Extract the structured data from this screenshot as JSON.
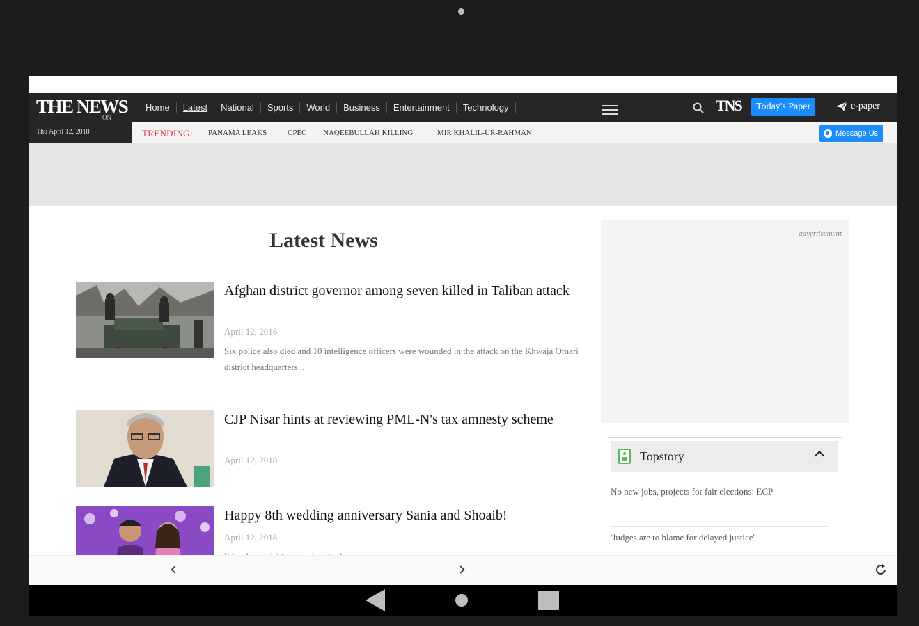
{
  "header": {
    "logo_text": "THE NEWS",
    "logo_tag": "ON",
    "date": "Thu April 12, 2018",
    "nav": [
      "Home",
      "Latest",
      "National",
      "Sports",
      "World",
      "Business",
      "Entertainment",
      "Technology"
    ],
    "active_nav": "Latest",
    "tns_logo": "TNS",
    "todays_paper": "Today's Paper",
    "epaper": "e-paper"
  },
  "trending": {
    "label": "TRENDING:",
    "items": [
      "PANAMA LEAKS",
      "CPEC",
      "NAQEEBULLAH KILLING",
      "MIR KHALIL-UR-RAHMAN"
    ]
  },
  "message_us": "Message Us",
  "main": {
    "section_title": "Latest News",
    "articles": [
      {
        "headline": "Afghan district governor among seven killed in Taliban attack",
        "date": "April 12, 2018",
        "summary": "Six police also died and 10 intelligence officers were wounded in the attack on the Khwaja Omari district headquarters..."
      },
      {
        "headline": "CJP Nisar hints at reviewing PML-N's tax amnesty scheme",
        "date": "April 12, 2018",
        "summary": ""
      },
      {
        "headline": "Happy 8th wedding anniversary Sania and Shoaib!",
        "date": "April 12, 2018",
        "summary": "It has been eight years since to da..."
      }
    ]
  },
  "sidebar": {
    "ad_label": "advertisement",
    "topstory_title": "Topstory",
    "topstory_items": [
      "No new jobs, projects for fair elections: ECP",
      "'Judges are to blame for delayed justice'"
    ]
  },
  "colors": {
    "accent": "#1a8cff",
    "trending": "#e03a3a",
    "header_bg": "#262626"
  }
}
